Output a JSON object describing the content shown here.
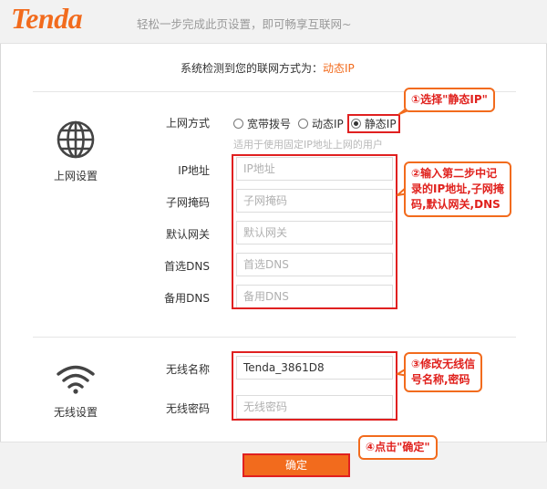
{
  "header": {
    "logo": "Tenda",
    "tagline": "轻松一步完成此页设置，即可畅享互联网~"
  },
  "detect": {
    "label": "系统检测到您的联网方式为：",
    "value": "动态IP"
  },
  "internet": {
    "section_label": "上网设置",
    "mode_label": "上网方式",
    "modes": [
      "宽带拨号",
      "动态IP",
      "静态IP"
    ],
    "selected_mode": "静态IP",
    "hint": "适用于使用固定IP地址上网的用户",
    "fields": [
      {
        "label": "IP地址",
        "placeholder": "IP地址"
      },
      {
        "label": "子网掩码",
        "placeholder": "子网掩码"
      },
      {
        "label": "默认网关",
        "placeholder": "默认网关"
      },
      {
        "label": "首选DNS",
        "placeholder": "首选DNS"
      },
      {
        "label": "备用DNS",
        "placeholder": "备用DNS"
      }
    ]
  },
  "wireless": {
    "section_label": "无线设置",
    "name_label": "无线名称",
    "name_value": "Tenda_3861D8",
    "password_label": "无线密码",
    "password_placeholder": "无线密码"
  },
  "callouts": {
    "c1": "①选择\"静态IP\"",
    "c2_lines": [
      "②输入第二步中记",
      "录的IP地址,子网掩",
      "码,默认网关,DNS"
    ],
    "c3_lines": [
      "③修改无线信",
      "号名称,密码"
    ],
    "c4": "④点击\"确定\""
  },
  "footer": {
    "confirm_label": "确定"
  },
  "colors": {
    "brand": "#f26b1d",
    "annotation": "#e02020"
  }
}
